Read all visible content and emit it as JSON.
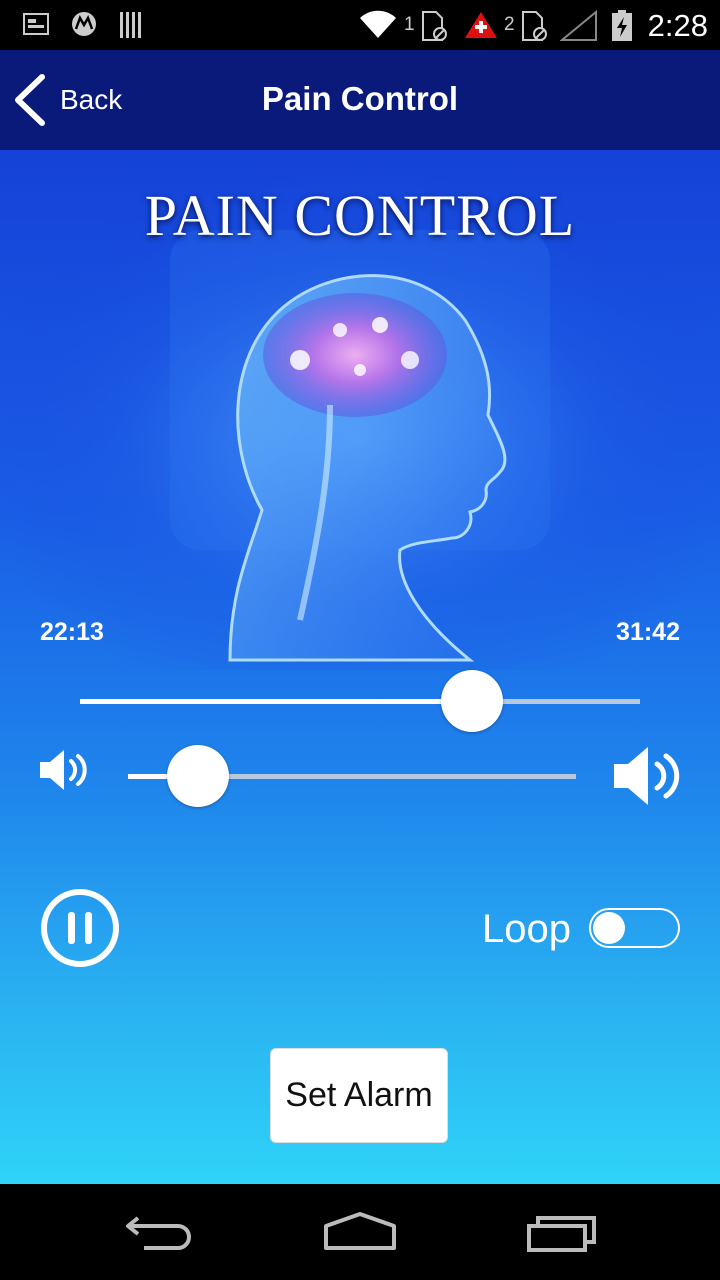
{
  "status_bar": {
    "time": "2:28",
    "sim1": "1",
    "sim2": "2",
    "icons": [
      "notification-icon",
      "motorola-icon",
      "barcode-icon",
      "wifi-icon",
      "sim-icon",
      "alert-icon",
      "sim-icon",
      "signal-icon",
      "battery-charging-icon"
    ]
  },
  "header": {
    "back_label": "Back",
    "title": "Pain Control"
  },
  "artwork": {
    "title": "PAIN CONTROL"
  },
  "player": {
    "elapsed": "22:13",
    "total": "31:42",
    "seek_progress": 0.7,
    "volume_level": 0.1
  },
  "controls": {
    "loop_label": "Loop",
    "loop_on": false,
    "alarm_label": "Set Alarm"
  },
  "colors": {
    "header_bg": "#0a1a7a",
    "gradient_top": "#1542d8",
    "gradient_bottom": "#2fd3f8"
  }
}
